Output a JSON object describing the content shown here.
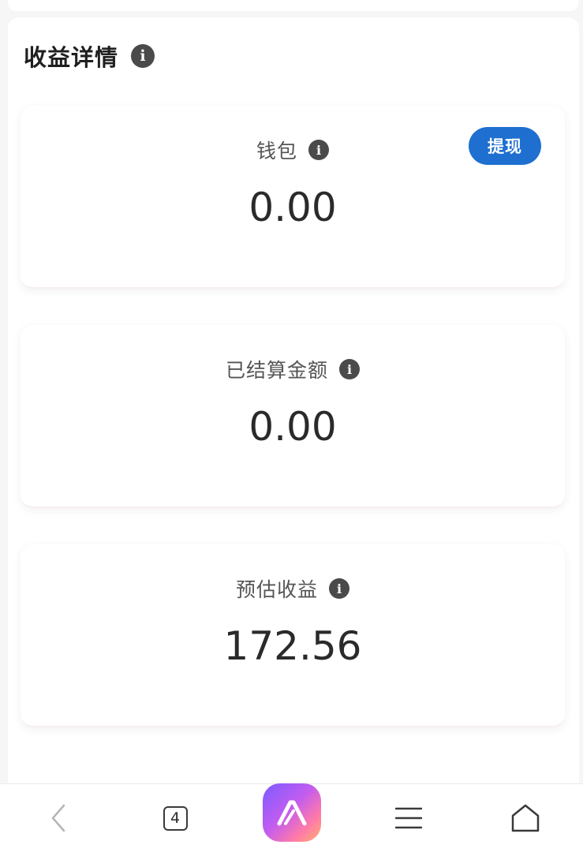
{
  "header": {
    "title": "收益详情",
    "info_icon": "info-icon"
  },
  "cards": [
    {
      "label": "钱包",
      "value": "0.00",
      "button_label": "提现"
    },
    {
      "label": "已结算金额",
      "value": "0.00"
    },
    {
      "label": "预估收益",
      "value": "172.56"
    }
  ],
  "bottom_nav": {
    "back_icon": "chevron-left-icon",
    "tabs_count": "4",
    "center_icon": "app-logo-icon",
    "menu_icon": "menu-icon",
    "home_icon": "home-icon"
  },
  "colors": {
    "accent": "#1e6fd0",
    "info_icon": "#4a4a4a",
    "background": "#f6f6f6"
  },
  "info_glyph": "i"
}
